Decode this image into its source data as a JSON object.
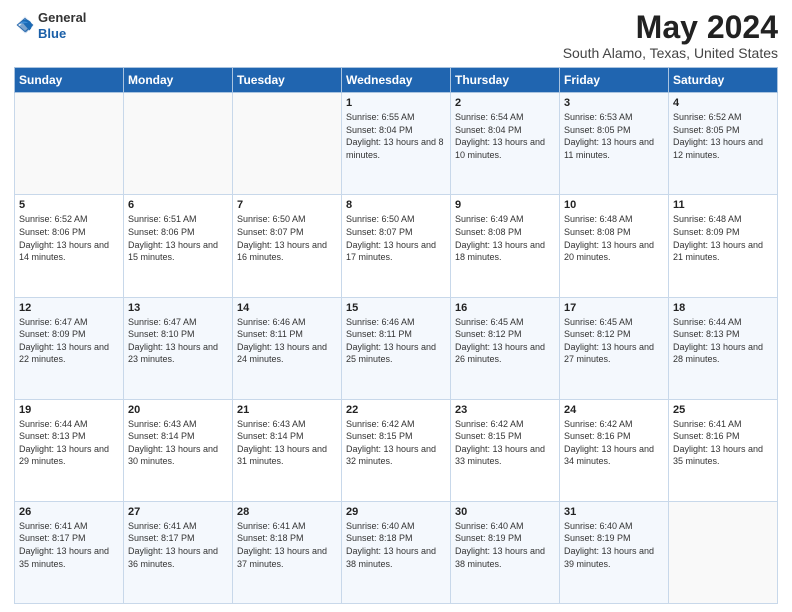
{
  "logo": {
    "general": "General",
    "blue": "Blue"
  },
  "title": "May 2024",
  "subtitle": "South Alamo, Texas, United States",
  "days_of_week": [
    "Sunday",
    "Monday",
    "Tuesday",
    "Wednesday",
    "Thursday",
    "Friday",
    "Saturday"
  ],
  "weeks": [
    [
      {
        "day": "",
        "sunrise": "",
        "sunset": "",
        "daylight": ""
      },
      {
        "day": "",
        "sunrise": "",
        "sunset": "",
        "daylight": ""
      },
      {
        "day": "",
        "sunrise": "",
        "sunset": "",
        "daylight": ""
      },
      {
        "day": "1",
        "sunrise": "6:55 AM",
        "sunset": "8:04 PM",
        "daylight": "13 hours and 8 minutes."
      },
      {
        "day": "2",
        "sunrise": "6:54 AM",
        "sunset": "8:04 PM",
        "daylight": "13 hours and 10 minutes."
      },
      {
        "day": "3",
        "sunrise": "6:53 AM",
        "sunset": "8:05 PM",
        "daylight": "13 hours and 11 minutes."
      },
      {
        "day": "4",
        "sunrise": "6:52 AM",
        "sunset": "8:05 PM",
        "daylight": "13 hours and 12 minutes."
      }
    ],
    [
      {
        "day": "5",
        "sunrise": "6:52 AM",
        "sunset": "8:06 PM",
        "daylight": "13 hours and 14 minutes."
      },
      {
        "day": "6",
        "sunrise": "6:51 AM",
        "sunset": "8:06 PM",
        "daylight": "13 hours and 15 minutes."
      },
      {
        "day": "7",
        "sunrise": "6:50 AM",
        "sunset": "8:07 PM",
        "daylight": "13 hours and 16 minutes."
      },
      {
        "day": "8",
        "sunrise": "6:50 AM",
        "sunset": "8:07 PM",
        "daylight": "13 hours and 17 minutes."
      },
      {
        "day": "9",
        "sunrise": "6:49 AM",
        "sunset": "8:08 PM",
        "daylight": "13 hours and 18 minutes."
      },
      {
        "day": "10",
        "sunrise": "6:48 AM",
        "sunset": "8:08 PM",
        "daylight": "13 hours and 20 minutes."
      },
      {
        "day": "11",
        "sunrise": "6:48 AM",
        "sunset": "8:09 PM",
        "daylight": "13 hours and 21 minutes."
      }
    ],
    [
      {
        "day": "12",
        "sunrise": "6:47 AM",
        "sunset": "8:09 PM",
        "daylight": "13 hours and 22 minutes."
      },
      {
        "day": "13",
        "sunrise": "6:47 AM",
        "sunset": "8:10 PM",
        "daylight": "13 hours and 23 minutes."
      },
      {
        "day": "14",
        "sunrise": "6:46 AM",
        "sunset": "8:11 PM",
        "daylight": "13 hours and 24 minutes."
      },
      {
        "day": "15",
        "sunrise": "6:46 AM",
        "sunset": "8:11 PM",
        "daylight": "13 hours and 25 minutes."
      },
      {
        "day": "16",
        "sunrise": "6:45 AM",
        "sunset": "8:12 PM",
        "daylight": "13 hours and 26 minutes."
      },
      {
        "day": "17",
        "sunrise": "6:45 AM",
        "sunset": "8:12 PM",
        "daylight": "13 hours and 27 minutes."
      },
      {
        "day": "18",
        "sunrise": "6:44 AM",
        "sunset": "8:13 PM",
        "daylight": "13 hours and 28 minutes."
      }
    ],
    [
      {
        "day": "19",
        "sunrise": "6:44 AM",
        "sunset": "8:13 PM",
        "daylight": "13 hours and 29 minutes."
      },
      {
        "day": "20",
        "sunrise": "6:43 AM",
        "sunset": "8:14 PM",
        "daylight": "13 hours and 30 minutes."
      },
      {
        "day": "21",
        "sunrise": "6:43 AM",
        "sunset": "8:14 PM",
        "daylight": "13 hours and 31 minutes."
      },
      {
        "day": "22",
        "sunrise": "6:42 AM",
        "sunset": "8:15 PM",
        "daylight": "13 hours and 32 minutes."
      },
      {
        "day": "23",
        "sunrise": "6:42 AM",
        "sunset": "8:15 PM",
        "daylight": "13 hours and 33 minutes."
      },
      {
        "day": "24",
        "sunrise": "6:42 AM",
        "sunset": "8:16 PM",
        "daylight": "13 hours and 34 minutes."
      },
      {
        "day": "25",
        "sunrise": "6:41 AM",
        "sunset": "8:16 PM",
        "daylight": "13 hours and 35 minutes."
      }
    ],
    [
      {
        "day": "26",
        "sunrise": "6:41 AM",
        "sunset": "8:17 PM",
        "daylight": "13 hours and 35 minutes."
      },
      {
        "day": "27",
        "sunrise": "6:41 AM",
        "sunset": "8:17 PM",
        "daylight": "13 hours and 36 minutes."
      },
      {
        "day": "28",
        "sunrise": "6:41 AM",
        "sunset": "8:18 PM",
        "daylight": "13 hours and 37 minutes."
      },
      {
        "day": "29",
        "sunrise": "6:40 AM",
        "sunset": "8:18 PM",
        "daylight": "13 hours and 38 minutes."
      },
      {
        "day": "30",
        "sunrise": "6:40 AM",
        "sunset": "8:19 PM",
        "daylight": "13 hours and 38 minutes."
      },
      {
        "day": "31",
        "sunrise": "6:40 AM",
        "sunset": "8:19 PM",
        "daylight": "13 hours and 39 minutes."
      },
      {
        "day": "",
        "sunrise": "",
        "sunset": "",
        "daylight": ""
      }
    ]
  ]
}
